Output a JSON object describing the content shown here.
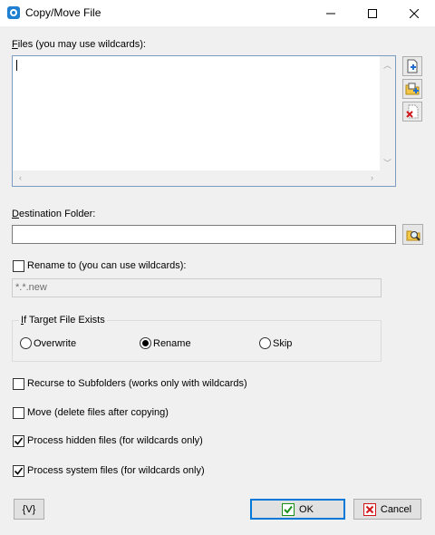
{
  "window": {
    "title": "Copy/Move File"
  },
  "files": {
    "label_underlined": "F",
    "label_rest": "iles (you may use wildcards):",
    "value": ""
  },
  "destination": {
    "label_underlined": "D",
    "label_rest": "estination Folder:",
    "value": ""
  },
  "rename": {
    "label": "Rename to (you can use wildcards):",
    "checked": false,
    "placeholder": "*.*.new"
  },
  "if_exists": {
    "title_underlined": "I",
    "title_rest": "f Target File Exists",
    "options": [
      "Overwrite",
      "Rename",
      "Skip"
    ],
    "selected": "Rename"
  },
  "options": {
    "recurse": {
      "label": "Recurse to Subfolders (works only with wildcards)",
      "checked": false
    },
    "move": {
      "label": "Move (delete files after copying)",
      "checked": false
    },
    "hidden": {
      "label": "Process hidden files (for wildcards only)",
      "checked": true
    },
    "system": {
      "label": "Process system files (for wildcards only)",
      "checked": true
    }
  },
  "buttons": {
    "variables": "{V}",
    "ok": "OK",
    "cancel": "Cancel"
  },
  "colors": {
    "accent": "#0078d7",
    "ok_check": "#1a8f1a",
    "cancel_x": "#d0161b"
  }
}
